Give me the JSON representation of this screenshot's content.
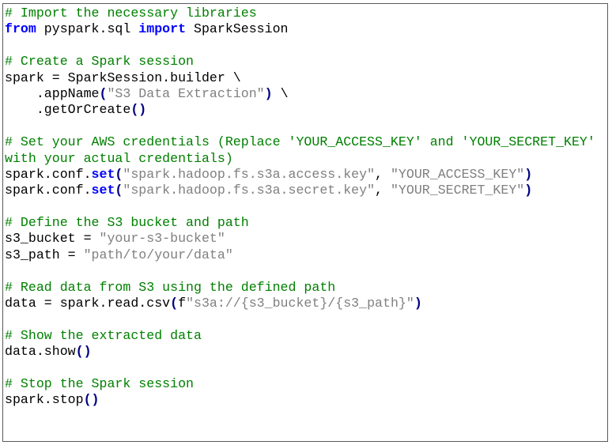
{
  "code": {
    "lines": [
      [
        {
          "t": "comment",
          "v": "# Import the necessary libraries"
        }
      ],
      [
        {
          "t": "keyword",
          "v": "from"
        },
        {
          "t": "plain",
          "v": " pyspark.sql "
        },
        {
          "t": "keyword",
          "v": "import"
        },
        {
          "t": "plain",
          "v": " SparkSession"
        }
      ],
      [],
      [
        {
          "t": "comment",
          "v": "# Create a Spark session"
        }
      ],
      [
        {
          "t": "plain",
          "v": "spark = SparkSession.builder \\"
        }
      ],
      [
        {
          "t": "plain",
          "v": "    .appName"
        },
        {
          "t": "paren",
          "v": "("
        },
        {
          "t": "string",
          "v": "\"S3 Data Extraction\""
        },
        {
          "t": "paren",
          "v": ")"
        },
        {
          "t": "plain",
          "v": " \\"
        }
      ],
      [
        {
          "t": "plain",
          "v": "    .getOrCreate"
        },
        {
          "t": "paren",
          "v": "()"
        }
      ],
      [],
      [
        {
          "t": "comment",
          "v": "# Set your AWS credentials (Replace 'YOUR_ACCESS_KEY' and 'YOUR_SECRET_KEY'"
        }
      ],
      [
        {
          "t": "comment",
          "v": "with your actual credentials)"
        }
      ],
      [
        {
          "t": "plain",
          "v": "spark.conf."
        },
        {
          "t": "method",
          "v": "set"
        },
        {
          "t": "paren",
          "v": "("
        },
        {
          "t": "string",
          "v": "\"spark.hadoop.fs.s3a.access.key\""
        },
        {
          "t": "plain",
          "v": ", "
        },
        {
          "t": "string",
          "v": "\"YOUR_ACCESS_KEY\""
        },
        {
          "t": "paren",
          "v": ")"
        }
      ],
      [
        {
          "t": "plain",
          "v": "spark.conf."
        },
        {
          "t": "method",
          "v": "set"
        },
        {
          "t": "paren",
          "v": "("
        },
        {
          "t": "string",
          "v": "\"spark.hadoop.fs.s3a.secret.key\""
        },
        {
          "t": "plain",
          "v": ", "
        },
        {
          "t": "string",
          "v": "\"YOUR_SECRET_KEY\""
        },
        {
          "t": "paren",
          "v": ")"
        }
      ],
      [],
      [
        {
          "t": "comment",
          "v": "# Define the S3 bucket and path"
        }
      ],
      [
        {
          "t": "plain",
          "v": "s3_bucket = "
        },
        {
          "t": "string",
          "v": "\"your-s3-bucket\""
        }
      ],
      [
        {
          "t": "plain",
          "v": "s3_path = "
        },
        {
          "t": "string",
          "v": "\"path/to/your/data\""
        }
      ],
      [],
      [
        {
          "t": "comment",
          "v": "# Read data from S3 using the defined path"
        }
      ],
      [
        {
          "t": "plain",
          "v": "data = spark.read.csv"
        },
        {
          "t": "paren",
          "v": "("
        },
        {
          "t": "plain",
          "v": "f"
        },
        {
          "t": "string",
          "v": "\"s3a://{s3_bucket}/{s3_path}\""
        },
        {
          "t": "paren",
          "v": ")"
        }
      ],
      [],
      [
        {
          "t": "comment",
          "v": "# Show the extracted data"
        }
      ],
      [
        {
          "t": "plain",
          "v": "data.show"
        },
        {
          "t": "paren",
          "v": "()"
        }
      ],
      [],
      [
        {
          "t": "comment",
          "v": "# Stop the Spark session"
        }
      ],
      [
        {
          "t": "plain",
          "v": "spark.stop"
        },
        {
          "t": "paren",
          "v": "()"
        }
      ]
    ]
  },
  "colors": {
    "comment": "#008000",
    "keyword": "#0000ff",
    "string": "#808080",
    "paren": "#000080",
    "plain": "#000000",
    "border": "#5a5a5a"
  }
}
